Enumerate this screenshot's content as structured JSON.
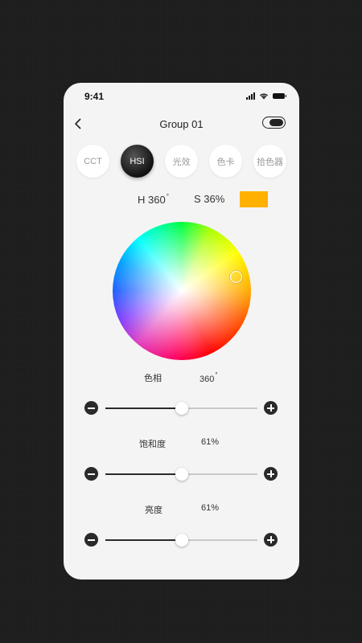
{
  "status": {
    "time": "9:41"
  },
  "header": {
    "title": "Group 01"
  },
  "tabs": [
    {
      "label": "CCT",
      "active": false
    },
    {
      "label": "HSI",
      "active": true
    },
    {
      "label": "光效",
      "active": false
    },
    {
      "label": "色卡",
      "active": false
    },
    {
      "label": "拾色器",
      "active": false
    }
  ],
  "readout": {
    "h_text": "H 360",
    "deg": "°",
    "s_text": "S 36%",
    "swatch_color": "#ffb000"
  },
  "sliders": [
    {
      "label": "色相",
      "value": "360",
      "deg": "°",
      "fraction": 0.5
    },
    {
      "label": "饱和度",
      "value": "61%",
      "fraction": 0.5
    },
    {
      "label": "亮度",
      "value": "61%",
      "fraction": 0.5
    }
  ],
  "colors": {
    "background": "#1c1c1c",
    "card": "#f4f4f4",
    "accent_dark": "#2a2a2a"
  }
}
